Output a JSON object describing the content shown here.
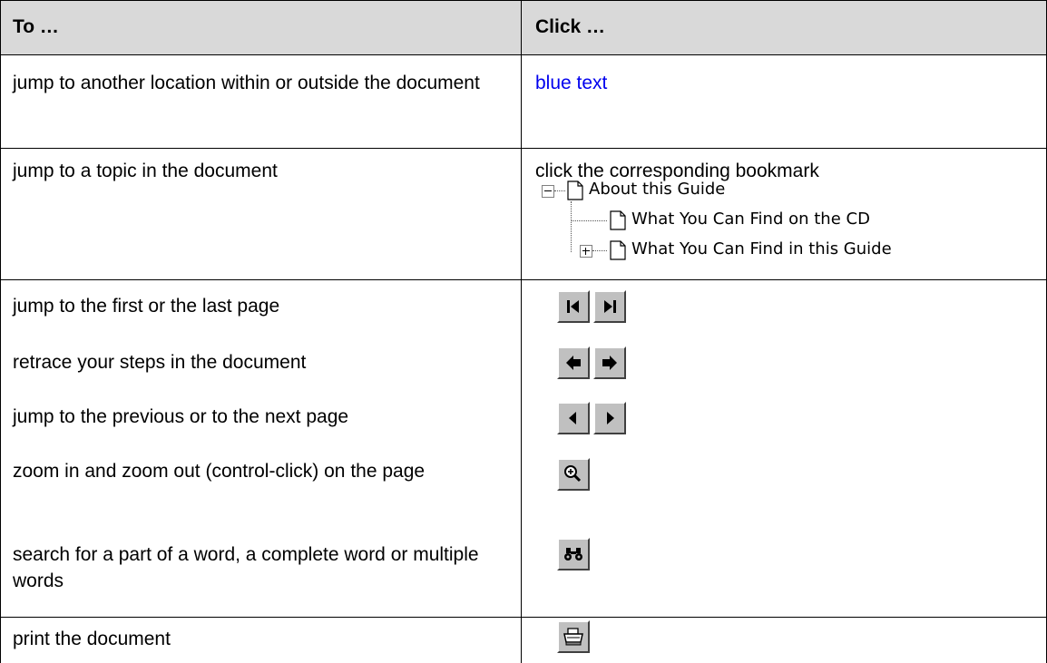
{
  "header": {
    "col1": "To …",
    "col2": "Click …"
  },
  "rows": [
    {
      "action": "jump to another location within or outside the document",
      "click_text": "blue text"
    },
    {
      "action": "jump to a topic in the document",
      "click_text": "click the corresponding bookmark"
    },
    {
      "action": "jump to the first or the last page",
      "icons": [
        "first-page-icon",
        "last-page-icon"
      ]
    },
    {
      "action": "retrace your steps in the document",
      "icons": [
        "go-back-icon",
        "go-forward-icon"
      ]
    },
    {
      "action": "jump to the previous or to the next page",
      "icons": [
        "previous-page-icon",
        "next-page-icon"
      ]
    },
    {
      "action": "zoom in and zoom out (control-click) on the page",
      "icons": [
        "zoom-in-icon"
      ]
    },
    {
      "action": "search for a part of a word, a complete word or multiple words",
      "icons": [
        "binoculars-icon"
      ]
    },
    {
      "action": "print the document",
      "icons": [
        "printer-icon"
      ]
    }
  ],
  "bookmark_tree": [
    {
      "label": "About this Guide",
      "expander": "minus",
      "level": 0
    },
    {
      "label": "What You Can Find on the CD",
      "expander": "none",
      "level": 1
    },
    {
      "label": "What You Can Find in this Guide",
      "expander": "plus",
      "level": 1
    }
  ],
  "colors": {
    "header_bg": "#d9d9d9",
    "link": "#0000ee",
    "button_face": "#c0c0c0"
  }
}
